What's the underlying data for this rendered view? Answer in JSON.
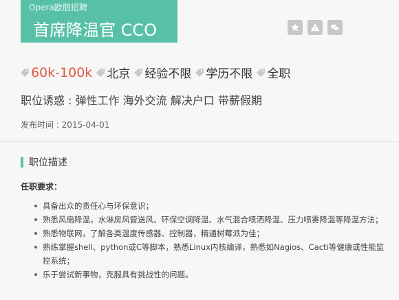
{
  "header": {
    "company": "Opera欧朋招聘",
    "job_title": "首席降温官 CCO",
    "actions": [
      {
        "icon": "star-icon"
      },
      {
        "icon": "warning-icon"
      },
      {
        "icon": "wechat-icon"
      }
    ],
    "brand_color": "#58c0a6"
  },
  "tags": {
    "salary": "60k-100k",
    "city": "北京",
    "experience": "经验不限",
    "education": "学历不限",
    "job_type": "全职",
    "salary_color": "#e05a3f"
  },
  "perks": "职位诱惑 : 弹性工作 海外交流 解决户口 带薪假期",
  "posted": "发布时间 : 2015-04-01",
  "description": {
    "section_title": "职位描述",
    "requirements_label": "任职要求：",
    "requirements": [
      "具备出众的责任心与环保意识；",
      "熟悉风扇降温，水淋房风管送风、环保空调降温、水气混合喷洒降温、压力喷雾降温等降温方法；",
      "熟悉物联网，了解各类温度传感器、控制器，精通树莓派为佳；",
      "熟练掌握shell、python或C等脚本，熟悉Linux内核编译，熟悉如Nagios、Cacti等健康或性能监控系统；",
      "乐于尝试新事物，克服具有挑战性的问题。"
    ]
  }
}
